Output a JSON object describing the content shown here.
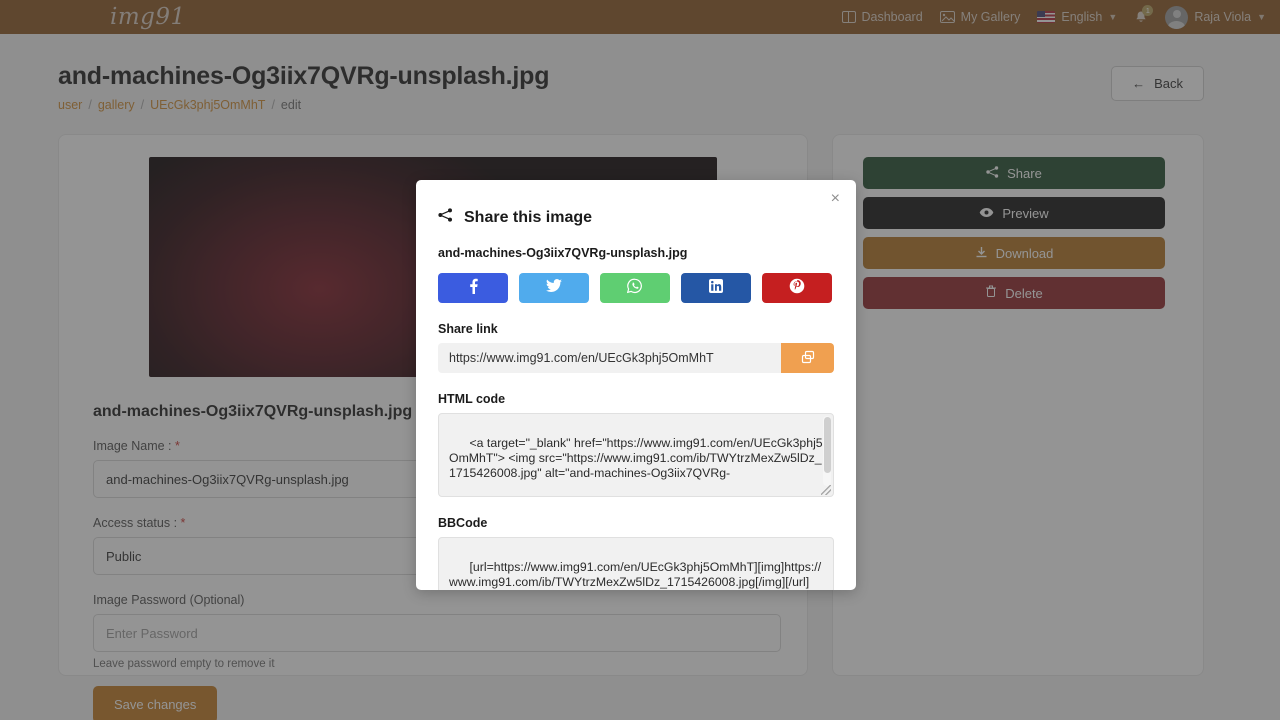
{
  "navbar": {
    "brand": "img91",
    "items": [
      {
        "label": "Dashboard",
        "icon": "dashboard-icon"
      },
      {
        "label": "My Gallery",
        "icon": "gallery-icon"
      },
      {
        "label": "English",
        "icon": "us-flag-icon"
      }
    ],
    "notification_count": "1",
    "user_name": "Raja Viola"
  },
  "header": {
    "title": "and-machines-Og3iix7QVRg-unsplash.jpg",
    "breadcrumb": {
      "user": "user",
      "gallery": "gallery",
      "id": "UEcGk3phj5OmMhT",
      "current": "edit",
      "separator": "/"
    },
    "back_label": "Back"
  },
  "form": {
    "file_caption": "and-machines-Og3iix7QVRg-unsplash.jpg",
    "image_name_label": "Image Name :",
    "image_name_value": "and-machines-Og3iix7QVRg-unsplash.jpg",
    "access_status_label": "Access status :",
    "access_status_value": "Public",
    "password_label": "Image Password (Optional)",
    "password_placeholder": "Enter Password",
    "password_hint": "Leave password empty to remove it",
    "save_label": "Save changes",
    "required_marker": "*"
  },
  "actions": [
    {
      "label": "Share",
      "icon": "share-icon",
      "color": "#1e4a2b"
    },
    {
      "label": "Preview",
      "icon": "eye-icon",
      "color": "#111111"
    },
    {
      "label": "Download",
      "icon": "download-icon",
      "color": "#b2721f"
    },
    {
      "label": "Delete",
      "icon": "trash-icon",
      "color": "#8e2226"
    }
  ],
  "modal": {
    "title": "Share this image",
    "close_label": "×",
    "file_name": "and-machines-Og3iix7QVRg-unsplash.jpg",
    "social": [
      {
        "name": "facebook",
        "color": "#3b5ce0"
      },
      {
        "name": "twitter",
        "color": "#50abed"
      },
      {
        "name": "whatsapp",
        "color": "#5fce72"
      },
      {
        "name": "linkedin",
        "color": "#2557a5"
      },
      {
        "name": "pinterest",
        "color": "#c51f20"
      }
    ],
    "share_link_label": "Share link",
    "share_link_value": "https://www.img91.com/en/UEcGk3phj5OmMhT",
    "html_code_label": "HTML code",
    "html_code_value": "<a target=\"_blank\" href=\"https://www.img91.com/en/UEcGk3phj5OmMhT\"> <img src=\"https://www.img91.com/ib/TWYtrzMexZw5lDz_1715426008.jpg\" alt=\"and-machines-Og3iix7QVRg-",
    "bbcode_label": "BBCode",
    "bbcode_value": "[url=https://www.img91.com/en/UEcGk3phj5OmMhT][img]https://www.img91.com/ib/TWYtrzMexZw5lDz_1715426008.jpg[/img][/url]"
  },
  "colors": {
    "navbar": "#8a5420",
    "accent": "#d08a2e",
    "copy_button": "#f0a050",
    "save_button": "#c07820"
  }
}
